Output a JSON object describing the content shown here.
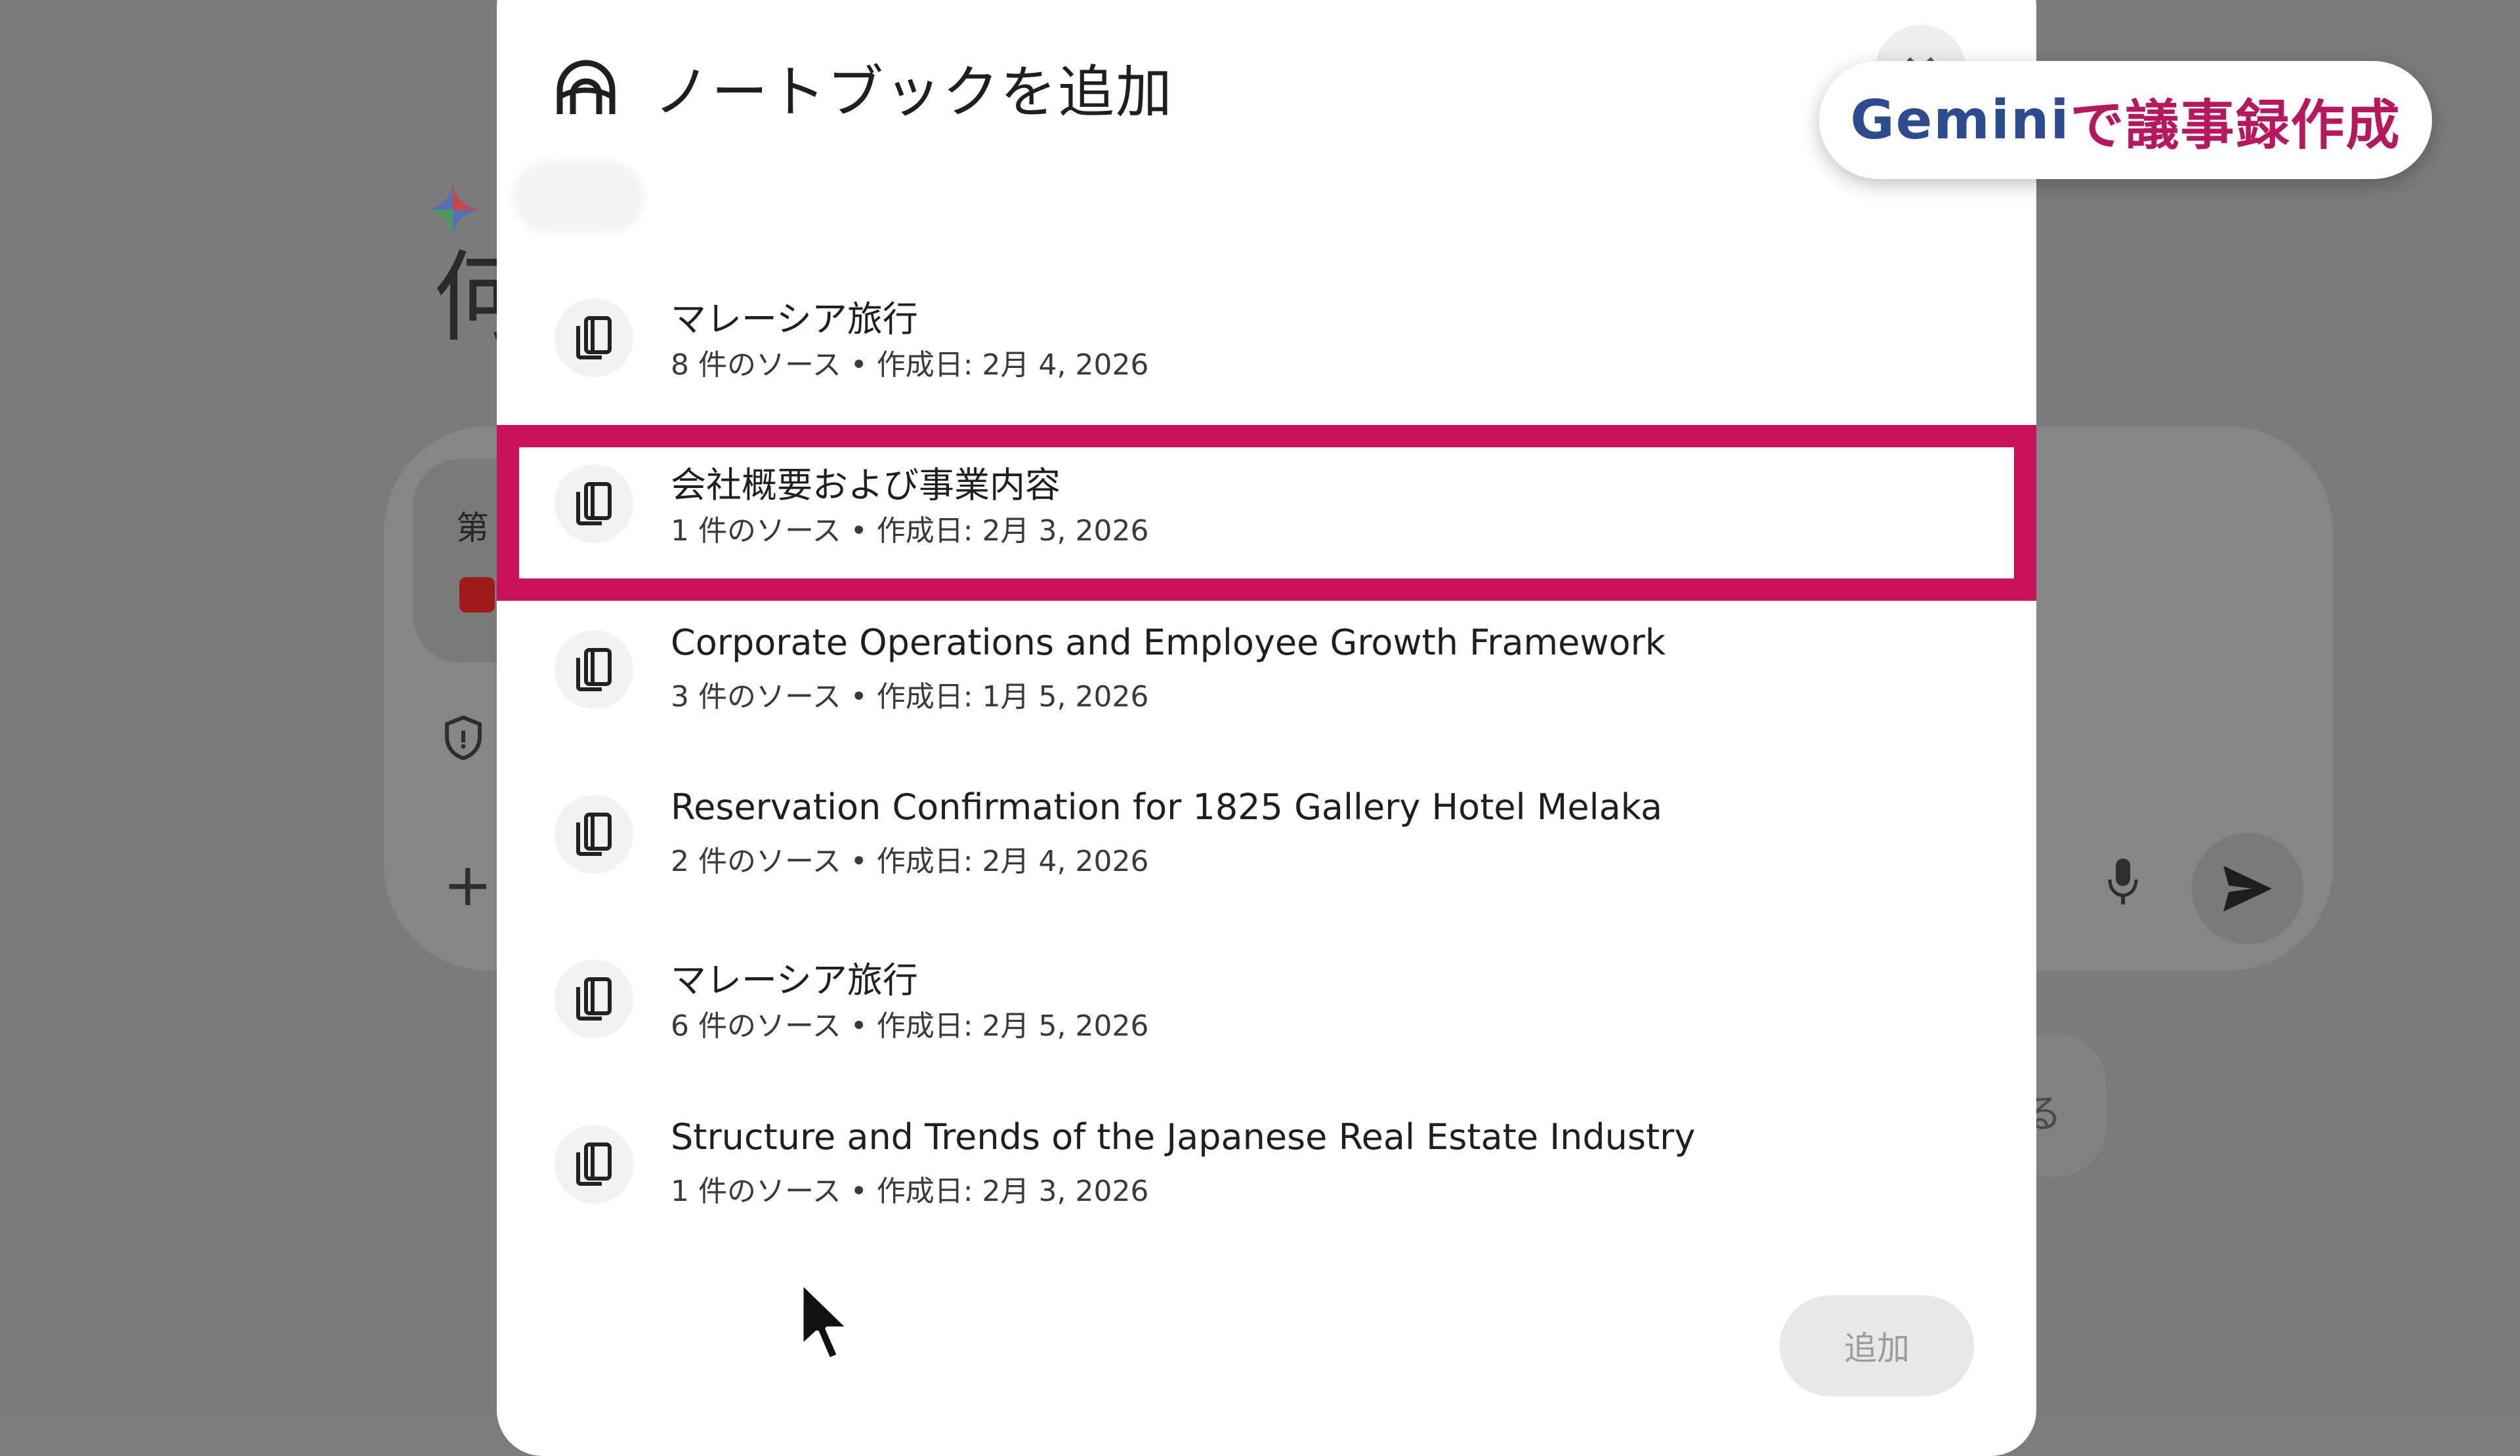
{
  "background": {
    "title_fragment": "何",
    "chip_fragment": "第",
    "pill_fragment": "る"
  },
  "dialog": {
    "title": "ノートブックを追加",
    "add_button_label": "追加",
    "notebooks": [
      {
        "title": "マレーシア旅行",
        "meta": "8 件のソース • 作成日: 2月 4, 2026",
        "selected": false
      },
      {
        "title": "会社概要および事業内容",
        "meta": "1 件のソース • 作成日: 2月 3, 2026",
        "selected": true
      },
      {
        "title": "Corporate Operations and Employee Growth Framework",
        "meta": "3 件のソース • 作成日: 1月 5, 2026",
        "selected": false
      },
      {
        "title": "Reservation Confirmation for 1825 Gallery Hotel Melaka",
        "meta": "2 件のソース • 作成日: 2月 4, 2026",
        "selected": false
      },
      {
        "title": "マレーシア旅行",
        "meta": "6 件のソース • 作成日: 2月 5, 2026",
        "selected": false
      },
      {
        "title": "Structure and Trends of the Japanese Real Estate Industry",
        "meta": "1 件のソース • 作成日: 2月 3, 2026",
        "selected": false
      }
    ]
  },
  "badge": {
    "part1": "Gemini",
    "part2": "で議事録作成"
  },
  "colors": {
    "highlight": "#c9125a",
    "badge_blue": "#2d4b8f",
    "badge_magenta": "#b5185e"
  },
  "icons": {
    "header": "notebooklm-icon",
    "row": "notebook-copy-icon",
    "cursor": "mouse-pointer-icon"
  }
}
